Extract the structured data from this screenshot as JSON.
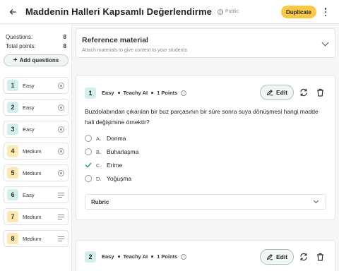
{
  "header": {
    "title": "Maddenin Halleri Kapsamlı Değerlendirme",
    "visibility": "Public",
    "duplicate_label": "Duplicate"
  },
  "sidebar": {
    "questions_label": "Questions:",
    "questions_value": "8",
    "points_label": "Total points:",
    "points_value": "8",
    "add_questions_label": "Add questions",
    "items": [
      {
        "num": "1",
        "difficulty": "Easy",
        "level": "easy",
        "icon": "radio-icon"
      },
      {
        "num": "2",
        "difficulty": "Easy",
        "level": "easy",
        "icon": "radio-icon"
      },
      {
        "num": "3",
        "difficulty": "Easy",
        "level": "easy",
        "icon": "radio-icon"
      },
      {
        "num": "4",
        "difficulty": "Medium",
        "level": "medium",
        "icon": "radio-icon"
      },
      {
        "num": "5",
        "difficulty": "Medium",
        "level": "medium",
        "icon": "radio-icon"
      },
      {
        "num": "6",
        "difficulty": "Easy",
        "level": "easy",
        "icon": "lines-icon"
      },
      {
        "num": "7",
        "difficulty": "Medium",
        "level": "medium",
        "icon": "lines-icon"
      },
      {
        "num": "8",
        "difficulty": "Medium",
        "level": "medium",
        "icon": "lines-icon"
      }
    ]
  },
  "reference": {
    "title": "Reference material",
    "subtitle": "Attach materials to give context to your students"
  },
  "questions": [
    {
      "num": "1",
      "difficulty": "Easy",
      "author": "Teachy AI",
      "points": "1 Points",
      "edit_label": "Edit",
      "text": "Buzdolabından çıkarılan bir buz parçasının bir süre sonra suya dönüşmesi hangi madde hali değişimine örnektir?",
      "options": [
        {
          "letter": "A.",
          "text": "Donma",
          "correct": false
        },
        {
          "letter": "B.",
          "text": "Buharlaşma",
          "correct": false
        },
        {
          "letter": "C.",
          "text": "Erime",
          "correct": true
        },
        {
          "letter": "D.",
          "text": "Yoğuşma",
          "correct": false
        }
      ],
      "rubric_label": "Rubric"
    },
    {
      "num": "2",
      "difficulty": "Easy",
      "author": "Teachy AI",
      "points": "1 Points",
      "edit_label": "Edit"
    }
  ],
  "colors": {
    "accent_yellow": "#f9c840",
    "easy": "#d3efec",
    "medium": "#fde9b0",
    "correct": "#2e9d6a"
  }
}
